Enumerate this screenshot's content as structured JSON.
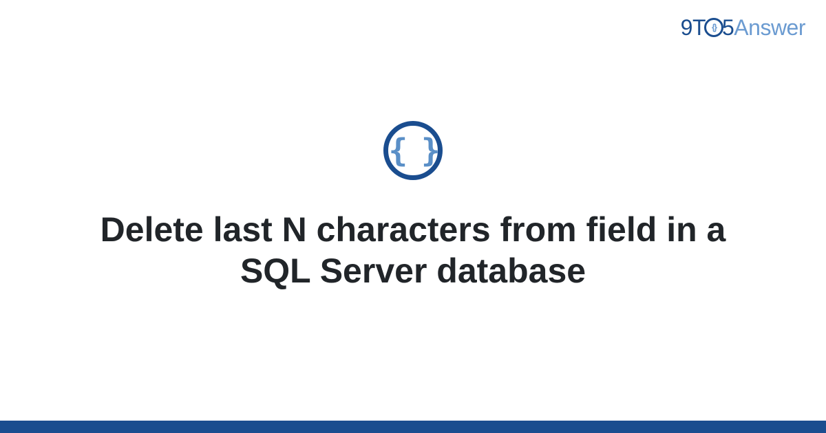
{
  "logo": {
    "part1": "9T",
    "o_inner": "{}",
    "part2": "5",
    "part3": "Answer"
  },
  "category_icon": {
    "glyph": "{ }"
  },
  "title": "Delete last N characters from field in a SQL Server database",
  "colors": {
    "primary": "#1a4d8f",
    "secondary": "#6b9bd1",
    "text": "#212529"
  }
}
